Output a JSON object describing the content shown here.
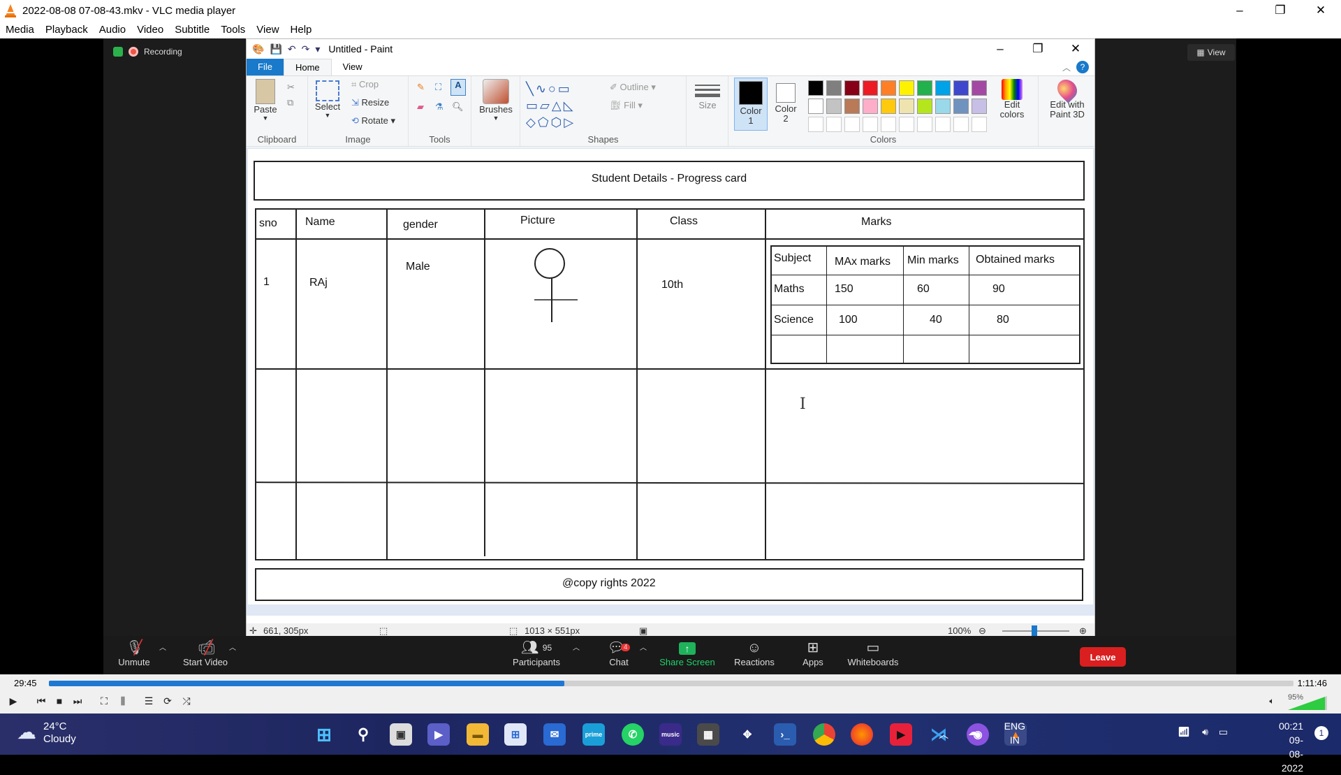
{
  "vlc": {
    "title": "2022-08-08 07-08-43.mkv - VLC media player",
    "menu": [
      "Media",
      "Playback",
      "Audio",
      "Video",
      "Subtitle",
      "Tools",
      "View",
      "Help"
    ],
    "time_current": "29:45",
    "time_total": "1:11:46",
    "progress": 0.414,
    "volume": "95%",
    "volume_level": 0.95
  },
  "zoom": {
    "recording_label": "Recording",
    "view_label": "View",
    "toolbar": {
      "unmute": "Unmute",
      "start_video": "Start Video",
      "participants": "Participants",
      "participants_count": "95",
      "chat": "Chat",
      "chat_badge": "4",
      "share_screen": "Share Screen",
      "reactions": "Reactions",
      "apps": "Apps",
      "whiteboards": "Whiteboards",
      "leave": "Leave"
    }
  },
  "paint": {
    "title": "Untitled - Paint",
    "tabs": [
      "File",
      "Home",
      "View"
    ],
    "ribbon": {
      "paste": "Paste",
      "clipboard": "Clipboard",
      "select": "Select",
      "crop": "Crop",
      "resize": "Resize",
      "rotate": "Rotate",
      "image": "Image",
      "tools": "Tools",
      "brushes": "Brushes",
      "outline": "Outline",
      "fill": "Fill",
      "shapes": "Shapes",
      "size": "Size",
      "color1": "Color\n1",
      "color2": "Color\n2",
      "edit_colors": "Edit\ncolors",
      "edit_paint3d": "Edit with\nPaint 3D",
      "colors": "Colors"
    },
    "palette_row1": [
      "#000000",
      "#7f7f7f",
      "#880015",
      "#ed1c24",
      "#ff7f27",
      "#fff200",
      "#22b14c",
      "#00a2e8",
      "#3f48cc",
      "#a349a4"
    ],
    "palette_row2": [
      "#ffffff",
      "#c3c3c3",
      "#b97a57",
      "#ffaec9",
      "#ffc90e",
      "#efe4b0",
      "#b5e61d",
      "#99d9ea",
      "#7092be",
      "#c8bfe7"
    ],
    "status": {
      "cursor_pos": "661, 305px",
      "canvas_size": "1013 × 551px",
      "zoom": "100%"
    },
    "card": {
      "title": "Student Details - Progress card",
      "headers": {
        "sno": "sno",
        "name": "Name",
        "gender": "gender",
        "picture": "Picture",
        "class": "Class",
        "marks": "Marks"
      },
      "row": {
        "sno": "1",
        "name": "RAj",
        "gender": "Male",
        "class": "10th"
      },
      "marks_headers": [
        "Subject",
        "MAx marks",
        "Min marks",
        "Obtained marks"
      ],
      "marks_rows": [
        [
          "Maths",
          "150",
          "60",
          "90"
        ],
        [
          "Science",
          "100",
          "40",
          "80"
        ]
      ],
      "footer": "@copy rights 2022"
    }
  },
  "taskbar": {
    "temperature": "24°C",
    "weather": "Cloudy",
    "lang": "ENG",
    "region": "IN",
    "time": "00:21",
    "date": "09-08-2022",
    "notification_count": "1"
  }
}
